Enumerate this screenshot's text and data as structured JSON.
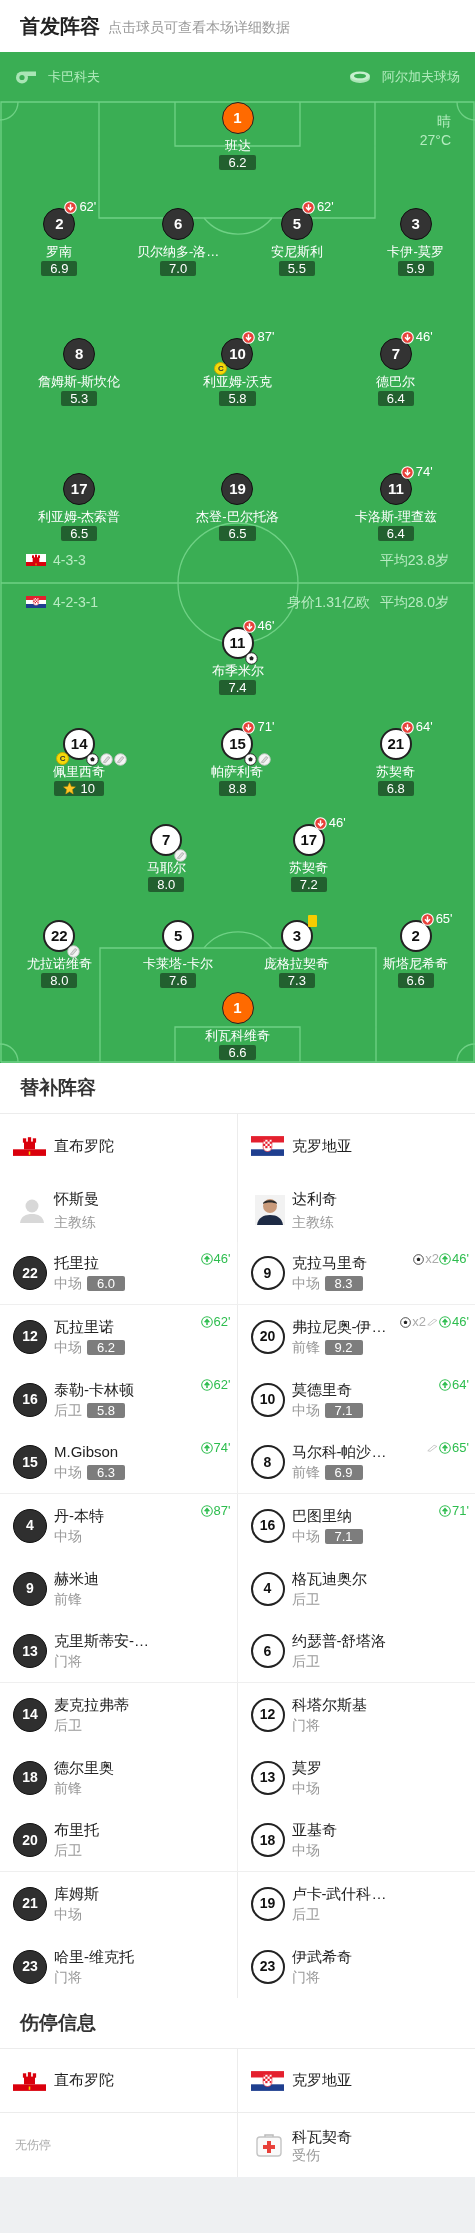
{
  "lineup_header": {
    "title": "首发阵容",
    "hint": "点击球员可查看本场详细数据"
  },
  "match_info": {
    "referee": "卡巴科夫",
    "stadium": "阿尔加夫球场",
    "weather": "晴",
    "temperature": "27°C"
  },
  "home": {
    "kind": "gibraltar",
    "formation": "4-3-3",
    "average_age": "平均23.8岁",
    "captain_badge": "C",
    "lines": [
      [
        {
          "number": "1",
          "name": "班达",
          "rating": "6.2",
          "kind": "goalkeeper",
          "captain": false,
          "mvp": false
        }
      ],
      [
        {
          "number": "2",
          "name": "罗南",
          "rating": "6.9",
          "kind": "outfield",
          "captain": false,
          "mvp": false,
          "sub_off": "62'"
        },
        {
          "number": "6",
          "name": "贝尔纳多-洛…",
          "rating": "7.0",
          "kind": "outfield",
          "captain": false,
          "mvp": false
        },
        {
          "number": "5",
          "name": "安尼斯利",
          "rating": "5.5",
          "kind": "outfield",
          "captain": false,
          "mvp": false,
          "sub_off": "62'"
        },
        {
          "number": "3",
          "name": "卡伊-莫罗",
          "rating": "5.9",
          "kind": "outfield",
          "captain": false,
          "mvp": false
        }
      ],
      [
        {
          "number": "8",
          "name": "詹姆斯-斯坎伦",
          "rating": "5.3",
          "kind": "outfield",
          "captain": false,
          "mvp": false
        },
        {
          "number": "10",
          "name": "利亚姆-沃克",
          "rating": "5.8",
          "kind": "outfield",
          "captain": true,
          "mvp": false,
          "sub_off": "87'"
        },
        {
          "number": "7",
          "name": "德巴尔",
          "rating": "6.4",
          "kind": "outfield",
          "captain": false,
          "mvp": false,
          "sub_off": "46'"
        }
      ],
      [
        {
          "number": "17",
          "name": "利亚姆-杰索普",
          "rating": "6.5",
          "kind": "outfield",
          "captain": false,
          "mvp": false
        },
        {
          "number": "19",
          "name": "杰登-巴尔托洛",
          "rating": "6.5",
          "kind": "outfield",
          "captain": false,
          "mvp": false
        },
        {
          "number": "11",
          "name": "卡洛斯-理查兹",
          "rating": "6.4",
          "kind": "outfield",
          "captain": false,
          "mvp": false,
          "sub_off": "74'"
        }
      ]
    ]
  },
  "away": {
    "kind": "croatia",
    "formation": "4-2-3-1",
    "market_value": "身价1.31亿欧",
    "average_age": "平均28.0岁",
    "captain_badge": "C",
    "lines": [
      [
        {
          "number": "11",
          "name": "布季米尔",
          "rating": "7.4",
          "kind": "outfield",
          "captain": false,
          "mvp": false,
          "sub_off": "46'",
          "events": [
            {
              "kind": "goal"
            }
          ]
        }
      ],
      [
        {
          "number": "14",
          "name": "佩里西奇",
          "rating": "10",
          "kind": "outfield",
          "captain": true,
          "mvp": true,
          "events": [
            {
              "kind": "goal"
            },
            {
              "kind": "assist"
            },
            {
              "kind": "assist"
            }
          ]
        },
        {
          "number": "15",
          "name": "帕萨利奇",
          "rating": "8.8",
          "kind": "outfield",
          "captain": false,
          "mvp": false,
          "sub_off": "71'",
          "events": [
            {
              "kind": "goal"
            },
            {
              "kind": "assist"
            }
          ]
        },
        {
          "number": "21",
          "name": "苏契奇",
          "rating": "6.8",
          "kind": "outfield",
          "captain": false,
          "mvp": false,
          "sub_off": "64'"
        }
      ],
      [
        {
          "number": "7",
          "name": "马耶尔",
          "rating": "8.0",
          "kind": "outfield",
          "captain": false,
          "mvp": false,
          "events": [
            {
              "kind": "assist"
            }
          ]
        },
        {
          "number": "17",
          "name": "苏契奇",
          "rating": "7.2",
          "kind": "outfield",
          "captain": false,
          "mvp": false,
          "sub_off": "46'"
        }
      ],
      [
        {
          "number": "22",
          "name": "尤拉诺维奇",
          "rating": "8.0",
          "kind": "outfield",
          "captain": false,
          "mvp": false,
          "events": [
            {
              "kind": "assist"
            }
          ]
        },
        {
          "number": "5",
          "name": "卡莱塔-卡尔",
          "rating": "7.6",
          "kind": "outfield",
          "captain": false,
          "mvp": false
        },
        {
          "number": "3",
          "name": "庞格拉契奇",
          "rating": "7.3",
          "kind": "outfield",
          "captain": false,
          "mvp": false,
          "events": [
            {
              "kind": "yellow_card"
            }
          ]
        },
        {
          "number": "2",
          "name": "斯塔尼希奇",
          "rating": "6.6",
          "kind": "outfield",
          "captain": false,
          "mvp": false,
          "sub_off": "65'"
        }
      ],
      [
        {
          "number": "1",
          "name": "利瓦科维奇",
          "rating": "6.6",
          "kind": "goalkeeper",
          "captain": false,
          "mvp": false
        }
      ]
    ]
  },
  "substitutes": {
    "title": "替补阵容",
    "teams": [
      {
        "team": "直布罗陀",
        "kind": "gibraltar",
        "coach": {
          "name": "怀斯曼",
          "role": "主教练",
          "photo": false
        },
        "players": [
          {
            "number": "22",
            "name": "托里拉",
            "position": "中场",
            "rating": "6.0",
            "events": [
              {
                "kind": "sub_on",
                "minute": "46'"
              }
            ]
          },
          {
            "number": "12",
            "name": "瓦拉里诺",
            "position": "中场",
            "rating": "6.2",
            "events": [
              {
                "kind": "sub_on",
                "minute": "62'"
              }
            ]
          },
          {
            "number": "16",
            "name": "泰勒-卡林顿",
            "position": "后卫",
            "rating": "5.8",
            "events": [
              {
                "kind": "sub_on",
                "minute": "62'"
              }
            ]
          },
          {
            "number": "15",
            "name": "M.Gibson",
            "position": "中场",
            "rating": "6.3",
            "events": [
              {
                "kind": "sub_on",
                "minute": "74'"
              }
            ]
          },
          {
            "number": "4",
            "name": "丹-本特",
            "position": "中场",
            "events": [
              {
                "kind": "sub_on",
                "minute": "87'"
              }
            ]
          },
          {
            "number": "9",
            "name": "赫米迪",
            "position": "前锋"
          },
          {
            "number": "13",
            "name": "克里斯蒂安-…",
            "position": "门将"
          },
          {
            "number": "14",
            "name": "麦克拉弗蒂",
            "position": "后卫"
          },
          {
            "number": "18",
            "name": "德尔里奥",
            "position": "前锋"
          },
          {
            "number": "20",
            "name": "布里托",
            "position": "后卫"
          },
          {
            "number": "21",
            "name": "库姆斯",
            "position": "中场"
          },
          {
            "number": "23",
            "name": "哈里-维克托",
            "position": "门将"
          }
        ]
      },
      {
        "team": "克罗地亚",
        "kind": "croatia",
        "coach": {
          "name": "达利奇",
          "role": "主教练",
          "photo": true
        },
        "players": [
          {
            "number": "9",
            "name": "克拉马里奇",
            "position": "中场",
            "rating": "8.3",
            "events": [
              {
                "kind": "goal",
                "count": "x2"
              },
              {
                "kind": "sub_on",
                "minute": "46'"
              }
            ]
          },
          {
            "number": "20",
            "name": "弗拉尼奥-伊…",
            "position": "前锋",
            "rating": "9.2",
            "events": [
              {
                "kind": "goal",
                "count": "x2"
              },
              {
                "kind": "assist"
              },
              {
                "kind": "sub_on",
                "minute": "46'"
              }
            ]
          },
          {
            "number": "10",
            "name": "莫德里奇",
            "position": "中场",
            "rating": "7.1",
            "events": [
              {
                "kind": "sub_on",
                "minute": "64'"
              }
            ]
          },
          {
            "number": "8",
            "name": "马尔科-帕沙…",
            "position": "前锋",
            "rating": "6.9",
            "events": [
              {
                "kind": "assist"
              },
              {
                "kind": "sub_on",
                "minute": "65'"
              }
            ]
          },
          {
            "number": "16",
            "name": "巴图里纳",
            "position": "中场",
            "rating": "7.1",
            "events": [
              {
                "kind": "sub_on",
                "minute": "71'"
              }
            ]
          },
          {
            "number": "4",
            "name": "格瓦迪奥尔",
            "position": "后卫"
          },
          {
            "number": "6",
            "name": "约瑟普-舒塔洛",
            "position": "后卫"
          },
          {
            "number": "12",
            "name": "科塔尔斯基",
            "position": "门将"
          },
          {
            "number": "13",
            "name": "莫罗",
            "position": "中场"
          },
          {
            "number": "18",
            "name": "亚基奇",
            "position": "中场"
          },
          {
            "number": "19",
            "name": "卢卡-武什科…",
            "position": "后卫"
          },
          {
            "number": "23",
            "name": "伊武希奇",
            "position": "门将"
          }
        ]
      }
    ]
  },
  "injuries": {
    "title": "伤停信息",
    "teams": [
      {
        "team": "直布罗陀",
        "kind": "gibraltar",
        "note": "无伤停"
      },
      {
        "team": "克罗地亚",
        "kind": "croatia",
        "players": [
          {
            "name": "科瓦契奇",
            "status": "受伤"
          }
        ]
      }
    ]
  }
}
